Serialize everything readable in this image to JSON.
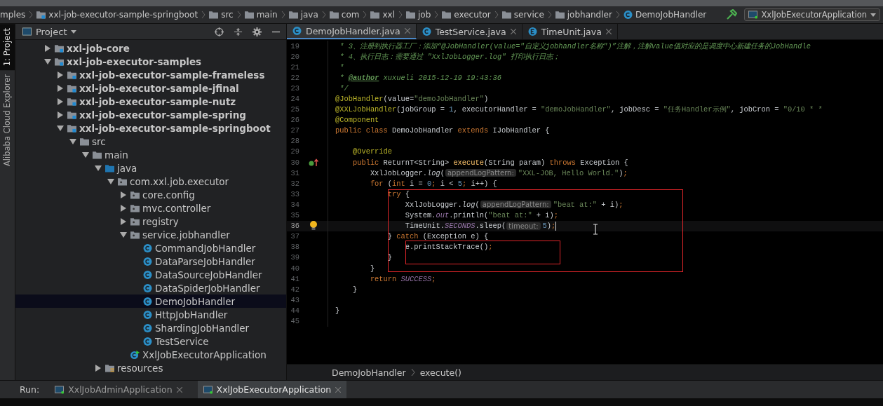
{
  "nav_bar": {
    "crumbs": [
      {
        "label": "mples",
        "kind": "text"
      },
      {
        "label": "xxl-job-executor-sample-springboot",
        "kind": "module"
      },
      {
        "label": "src",
        "kind": "folder"
      },
      {
        "label": "main",
        "kind": "folder"
      },
      {
        "label": "java",
        "kind": "folder"
      },
      {
        "label": "com",
        "kind": "folder"
      },
      {
        "label": "xxl",
        "kind": "folder"
      },
      {
        "label": "job",
        "kind": "folder"
      },
      {
        "label": "executor",
        "kind": "folder"
      },
      {
        "label": "service",
        "kind": "folder"
      },
      {
        "label": "jobhandler",
        "kind": "folder"
      },
      {
        "label": "DemoJobHandler",
        "kind": "class"
      }
    ],
    "run_config": "XxlJobExecutorApplication"
  },
  "side_strip": [
    {
      "label": "1: Project",
      "selected": true
    },
    {
      "label": "Alibaba Cloud Explorer",
      "selected": false
    }
  ],
  "project_panel": {
    "title": "Project",
    "tree": [
      {
        "label": "xxl-job-core",
        "kind": "module",
        "expanded": false,
        "selected": false
      },
      {
        "label": "xxl-job-executor-samples",
        "kind": "module",
        "expanded": true,
        "selected": false,
        "children": [
          {
            "label": "xxl-job-executor-sample-frameless",
            "kind": "module",
            "expanded": false,
            "selected": false
          },
          {
            "label": "xxl-job-executor-sample-jfinal",
            "kind": "module",
            "expanded": false,
            "selected": false
          },
          {
            "label": "xxl-job-executor-sample-nutz",
            "kind": "module",
            "expanded": false,
            "selected": false
          },
          {
            "label": "xxl-job-executor-sample-spring",
            "kind": "module",
            "expanded": false,
            "selected": false
          },
          {
            "label": "xxl-job-executor-sample-springboot",
            "kind": "module",
            "expanded": true,
            "selected": false,
            "children": [
              {
                "label": "src",
                "kind": "folder",
                "expanded": true,
                "selected": false,
                "children": [
                  {
                    "label": "main",
                    "kind": "folder",
                    "expanded": true,
                    "selected": false,
                    "children": [
                      {
                        "label": "java",
                        "kind": "source",
                        "expanded": true,
                        "selected": false,
                        "children": [
                          {
                            "label": "com.xxl.job.executor",
                            "kind": "package",
                            "expanded": true,
                            "selected": false,
                            "children": [
                              {
                                "label": "core.config",
                                "kind": "package",
                                "expanded": false,
                                "selected": false
                              },
                              {
                                "label": "mvc.controller",
                                "kind": "package",
                                "expanded": false,
                                "selected": false
                              },
                              {
                                "label": "registry",
                                "kind": "package",
                                "expanded": false,
                                "selected": false
                              },
                              {
                                "label": "service.jobhandler",
                                "kind": "package",
                                "expanded": true,
                                "selected": false,
                                "children": [
                                  {
                                    "label": "CommandJobHandler",
                                    "kind": "class",
                                    "selected": false
                                  },
                                  {
                                    "label": "DataParseJobHandler",
                                    "kind": "class",
                                    "selected": false
                                  },
                                  {
                                    "label": "DataSourceJobHandler",
                                    "kind": "class",
                                    "selected": false
                                  },
                                  {
                                    "label": "DataSpiderJobHandler",
                                    "kind": "class",
                                    "selected": false
                                  },
                                  {
                                    "label": "DemoJobHandler",
                                    "kind": "class",
                                    "selected": true
                                  },
                                  {
                                    "label": "HttpJobHandler",
                                    "kind": "class",
                                    "selected": false
                                  },
                                  {
                                    "label": "ShardingJobHandler",
                                    "kind": "class",
                                    "selected": false
                                  },
                                  {
                                    "label": "TestService",
                                    "kind": "class",
                                    "selected": false
                                  }
                                ]
                              },
                              {
                                "label": "XxlJobExecutorApplication",
                                "kind": "app",
                                "selected": false
                              }
                            ]
                          }
                        ]
                      },
                      {
                        "label": "resources",
                        "kind": "resources",
                        "expanded": false,
                        "selected": false
                      }
                    ]
                  }
                ]
              }
            ]
          }
        ]
      }
    ]
  },
  "editor": {
    "tabs": [
      {
        "label": "DemoJobHandler.java",
        "kind": "class",
        "selected": true
      },
      {
        "label": "TestService.java",
        "kind": "class",
        "selected": false
      },
      {
        "label": "TimeUnit.java",
        "kind": "enum",
        "selected": false
      }
    ],
    "lines": [
      {
        "number": "19",
        "current": false,
        "tokens": [
          {
            "t": " * 3、注册到执行器工厂：添加“@JobHandler(value=\"自定义jobhandler名称\")”注解，注解value值对应的是调度中心新建任务的JobHandle",
            "kind": "cmt"
          }
        ]
      },
      {
        "number": "20",
        "current": false,
        "tokens": [
          {
            "t": " * 4、执行日志：需要通过 \"XxlJobLogger.log\" 打印执行日志；",
            "kind": "cmt"
          }
        ]
      },
      {
        "number": "21",
        "current": false,
        "tokens": [
          {
            "t": " *",
            "kind": "cmt"
          }
        ]
      },
      {
        "number": "22",
        "current": false,
        "tokens": [
          {
            "t": " * ",
            "kind": "cmt"
          },
          {
            "t": "@author",
            "kind": "doctag"
          },
          {
            "t": " xuxueli 2015-12-19 19:43:36",
            "kind": "cmt"
          }
        ]
      },
      {
        "number": "23",
        "current": false,
        "tokens": [
          {
            "t": " */",
            "kind": "cmt"
          }
        ]
      },
      {
        "number": "24",
        "current": false,
        "tokens": [
          {
            "t": "@JobHandler",
            "kind": "ann"
          },
          {
            "t": "(value=",
            "kind": "plain"
          },
          {
            "t": "\"demoJobHandler\"",
            "kind": "str"
          },
          {
            "t": ")",
            "kind": "plain"
          }
        ]
      },
      {
        "number": "25",
        "current": false,
        "tokens": [
          {
            "t": "@XXLJobHandler",
            "kind": "ann"
          },
          {
            "t": "(jobGroup = ",
            "kind": "plain"
          },
          {
            "t": "1",
            "kind": "num"
          },
          {
            "t": ", executorHandler = ",
            "kind": "plain"
          },
          {
            "t": "\"demoJobHandler\"",
            "kind": "str"
          },
          {
            "t": ", jobDesc = ",
            "kind": "plain"
          },
          {
            "t": "\"任务Handler示例\"",
            "kind": "str"
          },
          {
            "t": ", jobCron = ",
            "kind": "plain"
          },
          {
            "t": "\"0/10 * *",
            "kind": "str"
          }
        ]
      },
      {
        "number": "26",
        "current": false,
        "tokens": [
          {
            "t": "@Component",
            "kind": "ann"
          }
        ]
      },
      {
        "number": "27",
        "current": false,
        "tokens": [
          {
            "t": "public class ",
            "kind": "kw"
          },
          {
            "t": "DemoJobHandler ",
            "kind": "plain"
          },
          {
            "t": "extends ",
            "kind": "kw"
          },
          {
            "t": "IJobHandler {",
            "kind": "plain"
          }
        ]
      },
      {
        "number": "28",
        "current": false
      },
      {
        "number": "29",
        "current": false,
        "tokens": [
          {
            "t": "    @Override",
            "kind": "ann"
          }
        ]
      },
      {
        "number": "30",
        "current": false,
        "gutter_icon": {
          "kind": "override"
        },
        "tokens": [
          {
            "t": "    public ",
            "kind": "kw"
          },
          {
            "t": "ReturnT<String> ",
            "kind": "plain"
          },
          {
            "t": "execute",
            "kind": "fn"
          },
          {
            "t": "(String param) ",
            "kind": "plain"
          },
          {
            "t": "throws ",
            "kind": "kw"
          },
          {
            "t": "Exception {",
            "kind": "plain"
          }
        ]
      },
      {
        "number": "31",
        "current": false,
        "tokens": [
          {
            "t": "        XxlJobLogger.",
            "kind": "plain"
          },
          {
            "t": "log",
            "kind": "ital"
          },
          {
            "t": "(",
            "kind": "plain"
          },
          {
            "t": "appendLogPattern:",
            "kind": "hint"
          },
          {
            "t": "\"XXL-JOB, Hello World.\"",
            "kind": "str"
          },
          {
            "t": ")",
            "kind": "plain"
          },
          {
            "t": ";",
            "kind": "kw"
          }
        ]
      },
      {
        "number": "32",
        "current": false,
        "tokens": [
          {
            "t": "        for ",
            "kind": "kw"
          },
          {
            "t": "(",
            "kind": "plain"
          },
          {
            "t": "int ",
            "kind": "kw"
          },
          {
            "t": "i = ",
            "kind": "plain"
          },
          {
            "t": "0",
            "kind": "num"
          },
          {
            "t": "; ",
            "kind": "kw"
          },
          {
            "t": "i < ",
            "kind": "plain"
          },
          {
            "t": "5",
            "kind": "num"
          },
          {
            "t": "; ",
            "kind": "kw"
          },
          {
            "t": "i++) {",
            "kind": "plain"
          }
        ]
      },
      {
        "number": "33",
        "current": false,
        "tokens": [
          {
            "t": "            try ",
            "kind": "kw"
          },
          {
            "t": "{",
            "kind": "plain"
          }
        ]
      },
      {
        "number": "34",
        "current": false,
        "tokens": [
          {
            "t": "                XxlJobLogger.",
            "kind": "plain"
          },
          {
            "t": "log",
            "kind": "ital"
          },
          {
            "t": "(",
            "kind": "plain"
          },
          {
            "t": "appendLogPattern:",
            "kind": "hint"
          },
          {
            "t": "\"beat at:\"",
            "kind": "str"
          },
          {
            "t": " + i)",
            "kind": "plain"
          },
          {
            "t": ";",
            "kind": "kw"
          }
        ]
      },
      {
        "number": "35",
        "current": false,
        "tokens": [
          {
            "t": "                System.",
            "kind": "plain"
          },
          {
            "t": "out",
            "kind": "field"
          },
          {
            "t": ".println(",
            "kind": "plain"
          },
          {
            "t": "\"beat at:\"",
            "kind": "str"
          },
          {
            "t": " + i)",
            "kind": "plain"
          },
          {
            "t": ";",
            "kind": "kw"
          }
        ]
      },
      {
        "number": "36",
        "current": true,
        "gutter_icon": {
          "kind": "bulb"
        },
        "tokens": [
          {
            "t": "                TimeUnit.",
            "kind": "plain"
          },
          {
            "t": "SECONDS",
            "kind": "field"
          },
          {
            "t": ".sleep(",
            "kind": "plain"
          },
          {
            "t": "timeout:",
            "kind": "hint"
          },
          {
            "t": "5",
            "kind": "num"
          },
          {
            "t": ")",
            "kind": "plain"
          },
          {
            "t": ";",
            "kind": "kw"
          }
        ]
      },
      {
        "number": "37",
        "current": false,
        "tokens": [
          {
            "t": "            } ",
            "kind": "plain"
          },
          {
            "t": "catch ",
            "kind": "kw"
          },
          {
            "t": "(Exception e) {",
            "kind": "plain"
          }
        ]
      },
      {
        "number": "38",
        "current": false,
        "tokens": [
          {
            "t": "                e.printStackTrace()",
            "kind": "plain"
          },
          {
            "t": ";",
            "kind": "kw"
          }
        ]
      },
      {
        "number": "39",
        "current": false,
        "tokens": [
          {
            "t": "            }",
            "kind": "plain"
          }
        ]
      },
      {
        "number": "40",
        "current": false,
        "tokens": [
          {
            "t": "        }",
            "kind": "plain"
          }
        ]
      },
      {
        "number": "41",
        "current": false,
        "tokens": [
          {
            "t": "        return ",
            "kind": "kw"
          },
          {
            "t": "SUCCESS",
            "kind": "field"
          },
          {
            "t": ";",
            "kind": "kw"
          }
        ]
      },
      {
        "number": "42",
        "current": false,
        "tokens": [
          {
            "t": "    }",
            "kind": "plain"
          }
        ]
      },
      {
        "number": "43",
        "current": false
      },
      {
        "number": "44",
        "current": false,
        "tokens": [
          {
            "t": "}",
            "kind": "plain"
          }
        ]
      },
      {
        "number": "45",
        "current": false
      }
    ],
    "breadcrumb": [
      "DemoJobHandler",
      "execute()"
    ]
  },
  "run_bar": {
    "label": "Run:",
    "tabs": [
      {
        "label": "XxlJobAdminApplication",
        "selected": false
      },
      {
        "label": "XxlJobExecutorApplication",
        "selected": true
      }
    ]
  }
}
